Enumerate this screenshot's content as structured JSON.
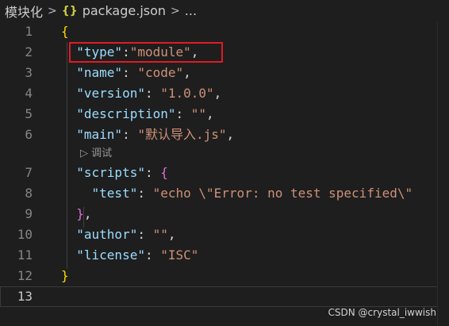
{
  "breadcrumb": {
    "folder": "模块化",
    "file_icon": "{}",
    "file": "package.json",
    "more": "..."
  },
  "gutter": [
    "1",
    "2",
    "3",
    "4",
    "5",
    "6",
    "7",
    "8",
    "9",
    "10",
    "11",
    "12",
    "13"
  ],
  "code": {
    "l1_brace": "{",
    "l2_key": "\"type\"",
    "l2_colon": ":",
    "l2_val": "\"module\"",
    "l2_comma": ",",
    "l3_key": "\"name\"",
    "l3_val": "\"code\"",
    "l4_key": "\"version\"",
    "l4_val": "\"1.0.0\"",
    "l5_key": "\"description\"",
    "l5_val": "\"\"",
    "l6_key": "\"main\"",
    "l6_val": "\"默认导入.js\"",
    "codelens": "调试",
    "l7_key": "\"scripts\"",
    "l7_brace": "{",
    "l8_key": "\"test\"",
    "l8_val": "\"echo \\\"Error: no test specified\\\"",
    "l9_brace": "}",
    "l10_key": "\"author\"",
    "l10_val": "\"\"",
    "l11_key": "\"license\"",
    "l11_val": "\"ISC\"",
    "l12_brace": "}"
  },
  "watermark": "CSDN @crystal_iwwish",
  "colors": {
    "background": "#1e1e1e",
    "key": "#9cdcfe",
    "string": "#ce9178",
    "brace_outer": "#ffd700",
    "brace_inner": "#da70d6",
    "highlight_box": "#e01b24"
  }
}
